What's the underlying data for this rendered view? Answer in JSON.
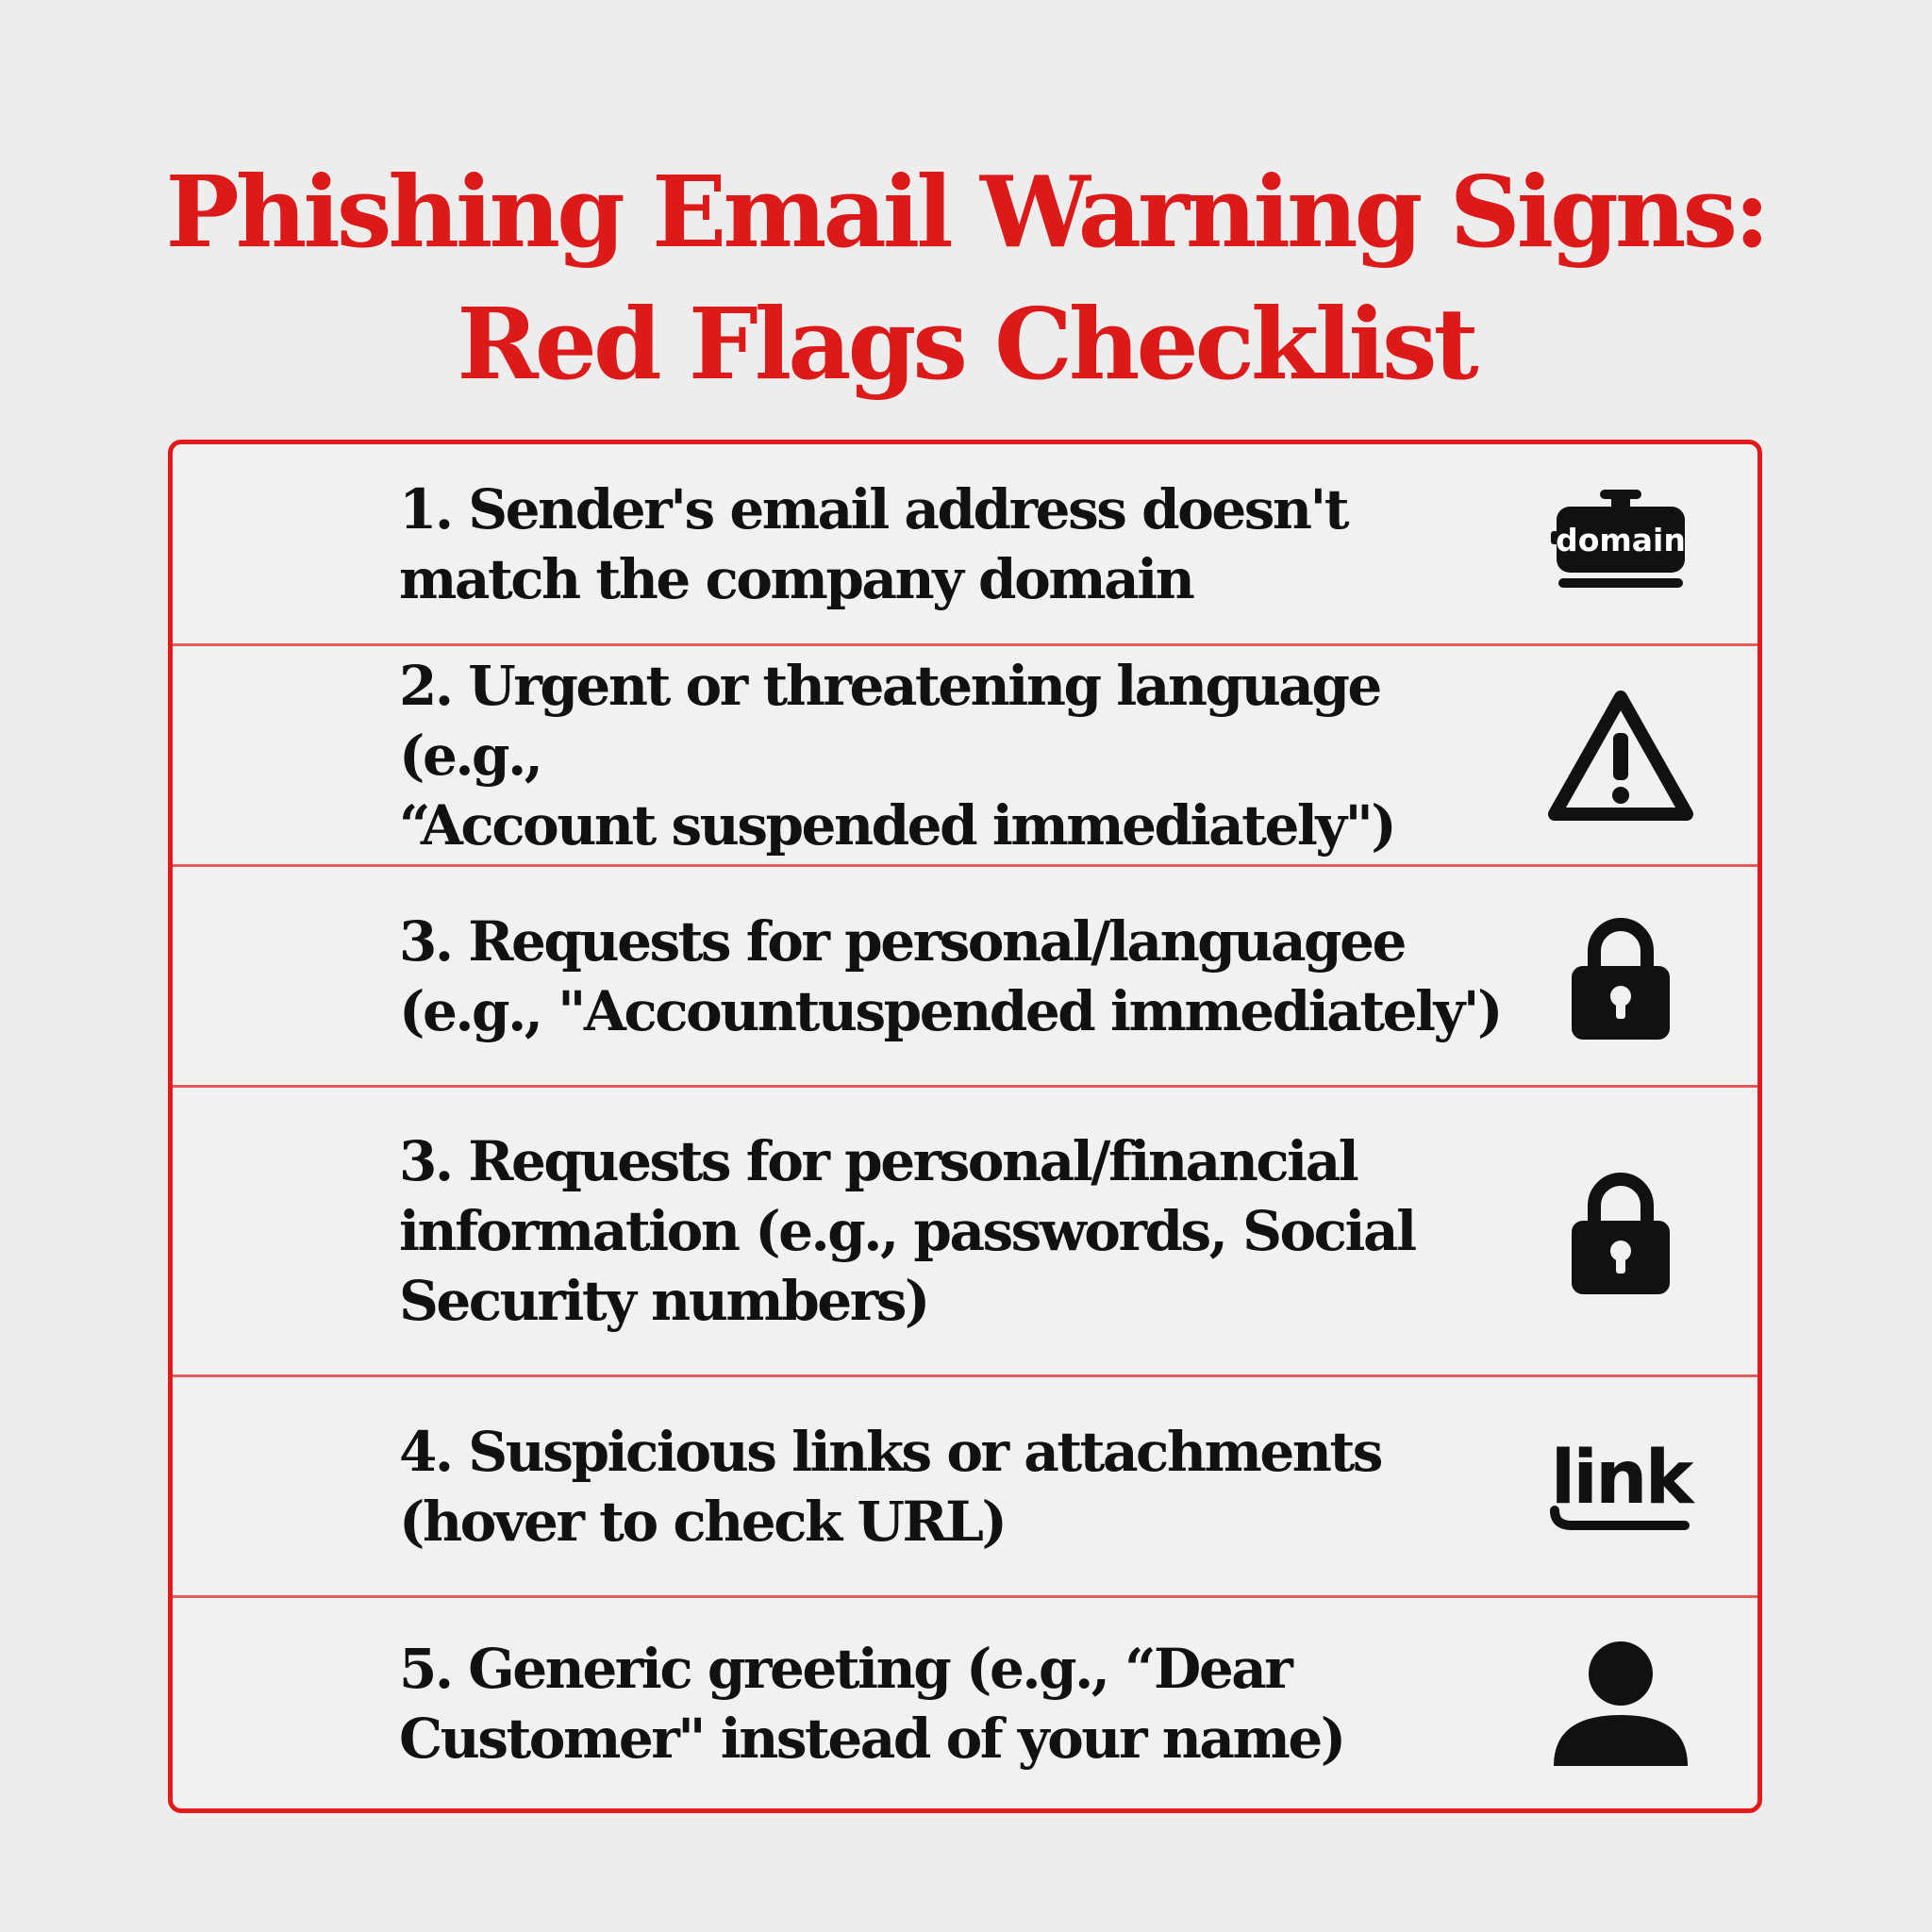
{
  "title": {
    "line1": "Phishing Email Warning Signs:",
    "line2": "Red Flags Checklist"
  },
  "colors": {
    "accent": "#dc1a1a",
    "text": "#111111",
    "background": "#ededed"
  },
  "items": [
    {
      "text": "1. Sender's email address doesn't\nmatch the company domain",
      "icon": "domain-icon",
      "icon_label": "domain"
    },
    {
      "text": "2. Urgent or threatening language (e.g.,\n“Account suspended immediately\")",
      "icon": "warning-icon"
    },
    {
      "text": "3. Requests for personal/languagee\n(e.g., \"Accountuspended immediately')",
      "icon": "lock-icon"
    },
    {
      "text": "3. Requests for personal/financial\ninformation (e.g., passwords, Social\nSecurity numbers)",
      "icon": "lock-icon"
    },
    {
      "text": "4. Suspicious links or attachments\n(hover to check URL)",
      "icon": "link-icon",
      "icon_label": "link"
    },
    {
      "text": "5. Generic greeting (e.g., “Dear\nCustomer\" instead of your name)",
      "icon": "user-icon"
    }
  ]
}
